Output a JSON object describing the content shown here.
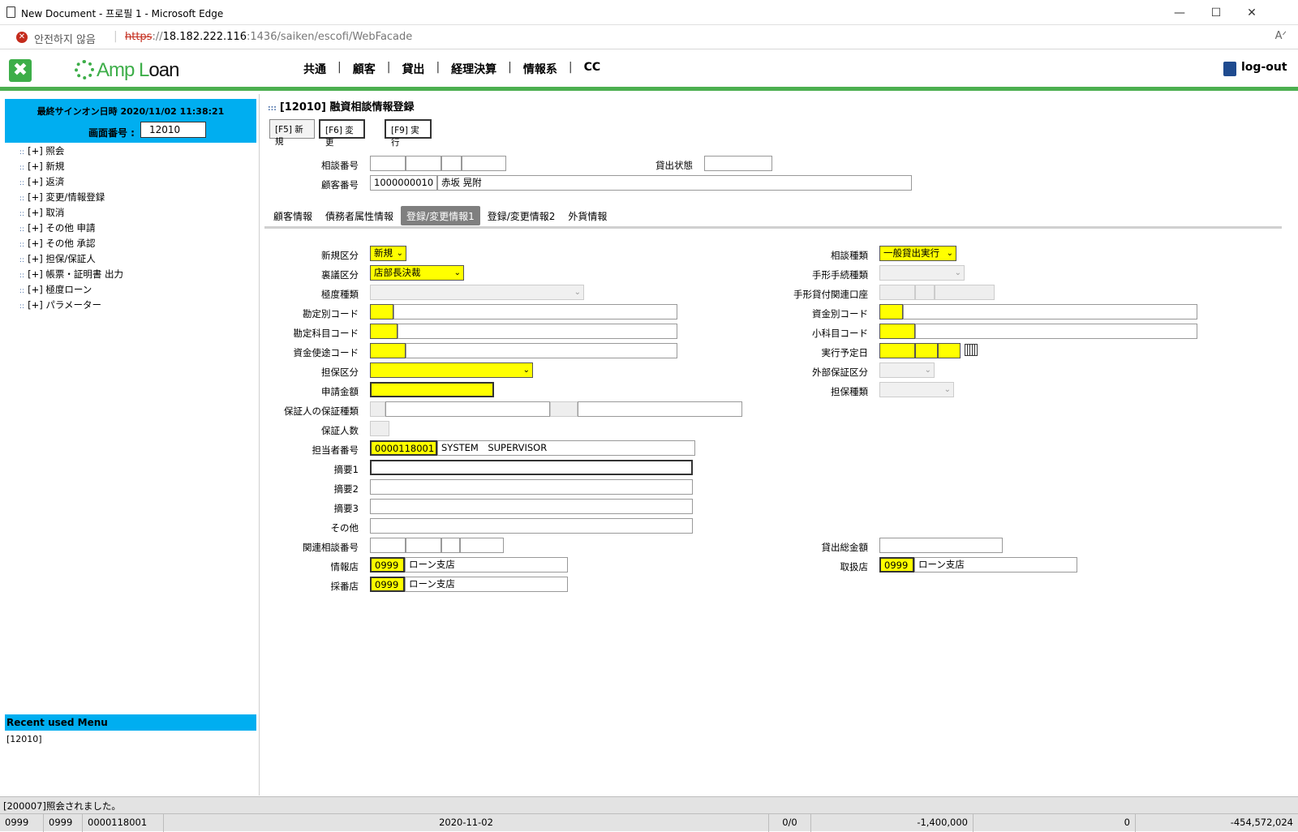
{
  "window": {
    "title": "New Document - 프로필 1 - Microsoft Edge",
    "minimize": "—",
    "maximize": "☐",
    "close": "✕"
  },
  "address": {
    "security_label": "안전하지 않음",
    "url_scheme": "https",
    "url_sep": "://",
    "url_host": "18.182.222.116",
    "url_rest": ":1436/saiken/escofi/WebFacade",
    "read_aloud": "Aᐟ"
  },
  "header": {
    "logo_glyph": "✖",
    "brand_a": "Amp",
    "brand_b": "L",
    "brand_c": "oan",
    "nav": [
      "共通",
      "顧客",
      "貸出",
      "経理決算",
      "情報系",
      "CC"
    ],
    "nav_sep": "|",
    "logout": "log-out"
  },
  "sidebar": {
    "signon": "最終サインオン日時 2020/11/02 11:38:21",
    "screen_label": "画面番号 :",
    "screen_no": "12010",
    "menu": [
      "[+] 照会",
      "[+] 新規",
      "[+] 返済",
      "[+] 変更/情報登録",
      "[+] 取消",
      "[+] その他 申請",
      "[+] その他 承認",
      "[+] 担保/保証人",
      "[+] 帳票・証明書 出力",
      "[+] 極度ローン",
      "[+] パラメーター"
    ],
    "menu_dots": "::",
    "recent_title": "Recent used Menu",
    "recent_item": "[12010]"
  },
  "main": {
    "title_icon": ":::",
    "title": "[12010] 融資相談情報登録",
    "fkeys": [
      "[F5] 新規",
      "[F6] 変更",
      "[F9] 実行"
    ],
    "labels": {
      "consult_no": "相談番号",
      "loan_status": "貸出状態",
      "customer_no": "顧客番号",
      "new_kind": "新規区分",
      "approval_kind": "裏議区分",
      "limit_kind": "極度種類",
      "account_code": "勘定別コード",
      "subject_code": "勘定科目コード",
      "fund_use_code": "資金使途コード",
      "collateral_kind": "担保区分",
      "apply_amount": "申請金額",
      "guarantor_type": "保証人の保証種類",
      "guarantor_count": "保証人数",
      "staff_no": "担当者番号",
      "memo1": "摘要1",
      "memo2": "摘要2",
      "memo3": "摘要3",
      "other": "その他",
      "related_consult": "関連相談番号",
      "info_branch": "情報店",
      "adopt_branch": "採番店",
      "consult_type": "相談種類",
      "bill_proc": "手形手続種類",
      "bill_account": "手形貸付関連口座",
      "fund_code": "資金別コード",
      "minor_code": "小科目コード",
      "exec_date": "実行予定日",
      "ext_guarantee": "外部保証区分",
      "collateral_type": "担保種類",
      "total_loan": "貸出総金額",
      "handle_branch": "取扱店"
    },
    "values": {
      "customer_no": "1000000010",
      "customer_name": "赤坂 晃附",
      "new_kind": "新規",
      "approval_kind": "店部長決裁",
      "consult_type": "一般貸出実行",
      "staff_no": "0000118001",
      "staff_name": "SYSTEM　SUPERVISOR",
      "info_branch_code": "0999",
      "info_branch_name": "ローン支店",
      "adopt_branch_code": "0999",
      "adopt_branch_name": "ローン支店",
      "handle_branch_code": "0999",
      "handle_branch_name": "ローン支店"
    },
    "caret": "⌄",
    "tabs": [
      "顧客情報",
      "債務者属性情報",
      "登録/変更情報1",
      "登録/変更情報2",
      "外貨情報"
    ],
    "active_tab": 2
  },
  "status": {
    "message": "[200007]照会されました。",
    "cells": [
      "0999",
      "0999",
      "0000118001",
      "2020-11-02",
      "0/0",
      "-1,400,000",
      "0",
      "-454,572,024"
    ]
  }
}
